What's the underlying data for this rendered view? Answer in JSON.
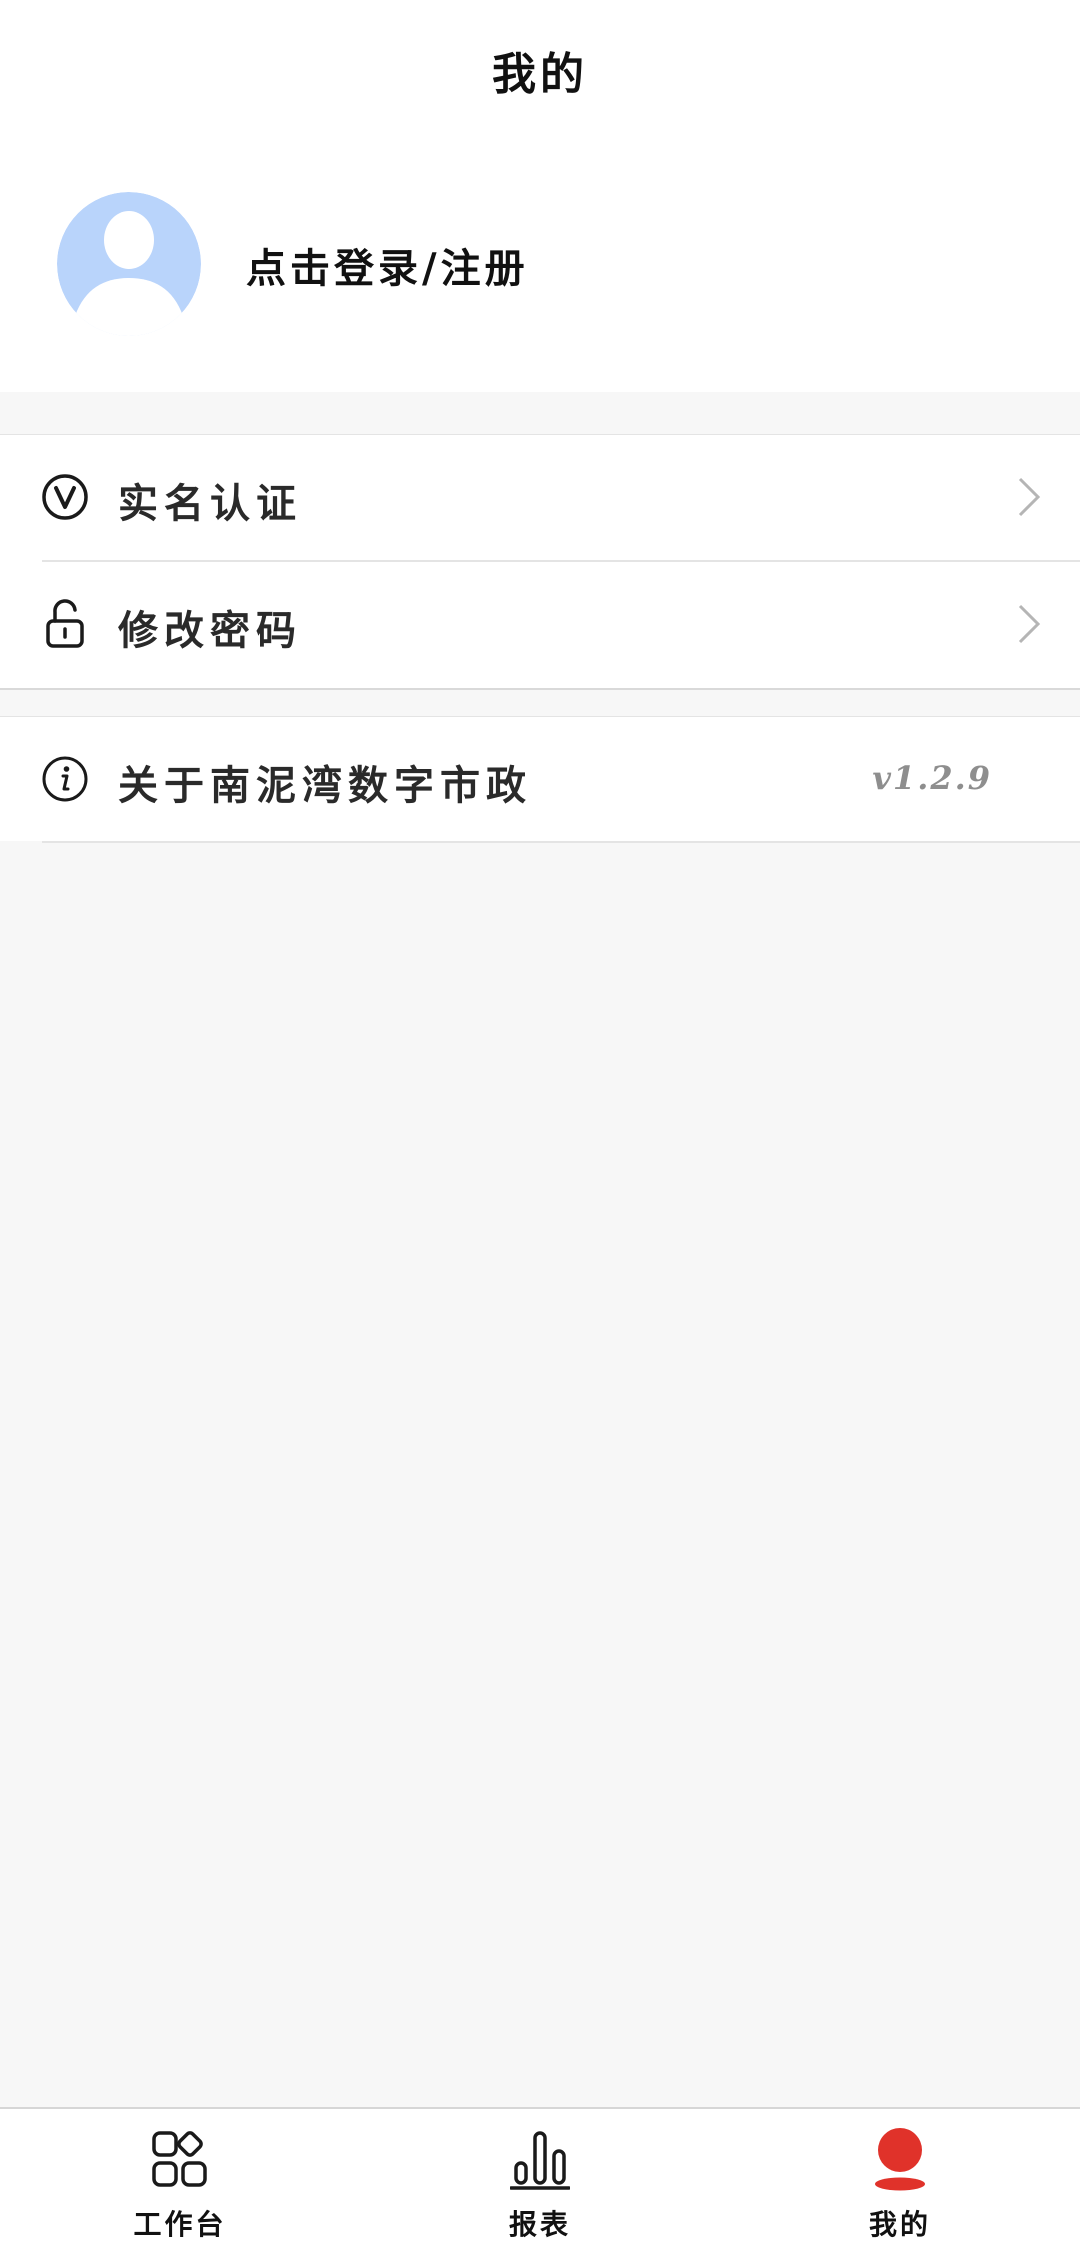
{
  "header": {
    "title": "我的"
  },
  "profile": {
    "login_label": "点击登录/注册",
    "avatar_color": "#b9d4fb"
  },
  "menu": {
    "real_name": {
      "label": "实名认证",
      "icon": "verified-v-icon"
    },
    "change_password": {
      "label": "修改密码",
      "icon": "unlock-icon"
    },
    "about": {
      "label": "关于南泥湾数字市政",
      "icon": "info-icon",
      "version": "v1.2.9"
    }
  },
  "tabs": [
    {
      "label": "工作台",
      "icon": "grid-apps-icon",
      "active": false
    },
    {
      "label": "报表",
      "icon": "bar-chart-icon",
      "active": false
    },
    {
      "label": "我的",
      "icon": "user-icon",
      "active": true
    }
  ],
  "colors": {
    "accent": "#e0322a",
    "text": "#1a1a1a",
    "muted": "#8e8e8e",
    "background": "#f7f7f7"
  }
}
